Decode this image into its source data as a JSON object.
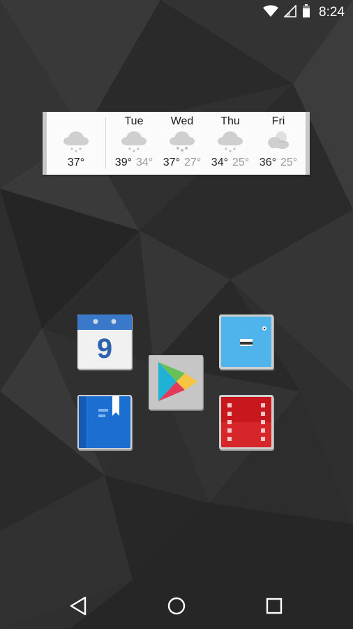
{
  "status_bar": {
    "time": "8:24",
    "icons": [
      "wifi-icon",
      "signal-icon",
      "battery-icon"
    ]
  },
  "weather": {
    "today": {
      "temp": "37°",
      "icon": "snow-cloud-icon"
    },
    "days": [
      {
        "day": "Tue",
        "high": "39°",
        "low": "34°",
        "icon": "snow-cloud-icon"
      },
      {
        "day": "Wed",
        "high": "37°",
        "low": "27°",
        "icon": "snow-cloud-icon"
      },
      {
        "day": "Thu",
        "high": "34°",
        "low": "25°",
        "icon": "snow-cloud-icon"
      },
      {
        "day": "Fri",
        "high": "36°",
        "low": "25°",
        "icon": "partly-cloudy-icon"
      }
    ]
  },
  "apps": {
    "calendar": {
      "day": "9",
      "icon": "calendar-icon"
    },
    "messenger": {
      "icon": "messenger-icon"
    },
    "play_store": {
      "icon": "play-store-icon"
    },
    "books": {
      "icon": "books-icon"
    },
    "movies": {
      "icon": "movies-icon"
    }
  },
  "nav": {
    "buttons": [
      "back-icon",
      "home-icon",
      "recents-icon"
    ]
  },
  "colors": {
    "calendar_blue": "#3a78c9",
    "messenger_blue": "#4fb4ec",
    "books_blue": "#1a6fd1",
    "movies_red": "#d6262a",
    "icon_frame": "#c9c9c9"
  }
}
